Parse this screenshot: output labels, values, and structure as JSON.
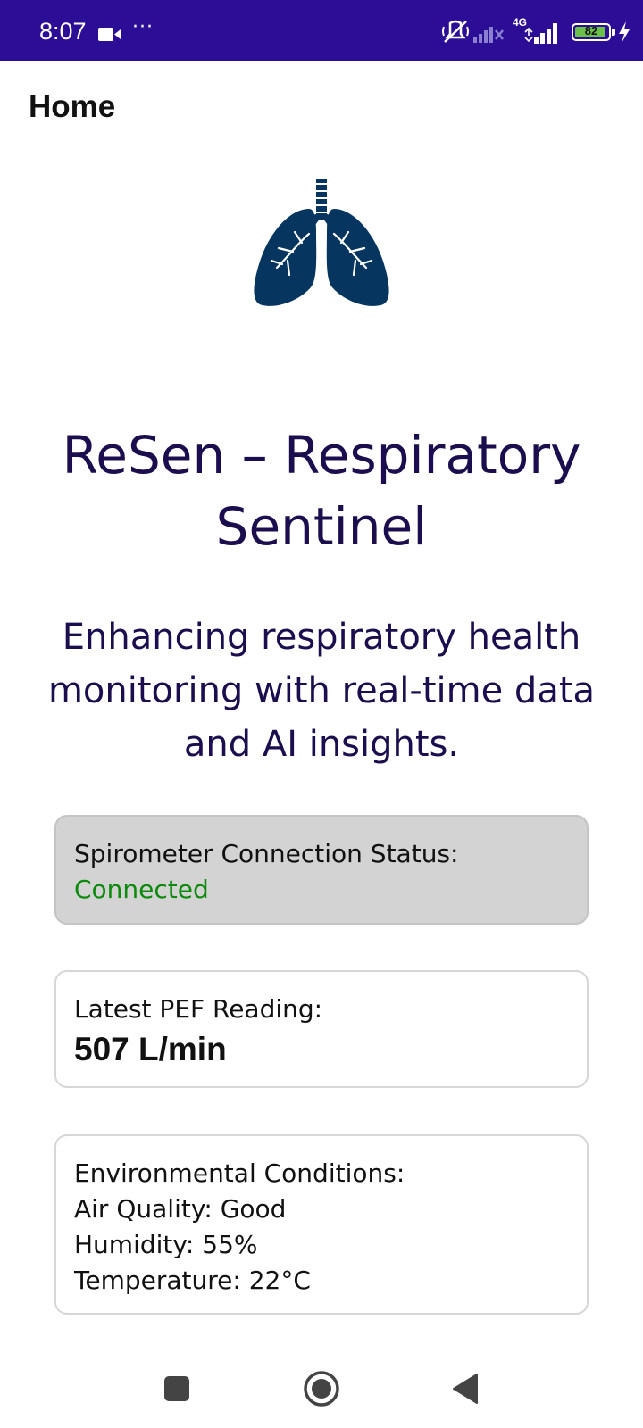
{
  "status_bar": {
    "time": "8:07",
    "dots": "···",
    "network": "4G",
    "battery": "82",
    "icons": [
      "video-camera-icon",
      "mute-icon",
      "signal-icon",
      "battery-icon",
      "charging-icon"
    ],
    "background": "#2c0d95"
  },
  "app_bar": {
    "title": "Home"
  },
  "logo": {
    "icon": "lungs-icon",
    "color": "#063660"
  },
  "main": {
    "title": "ReSen – Respiratory Sentinel",
    "tagline": "Enhancing respiratory health monitoring with real-time data and AI insights."
  },
  "connection_card": {
    "label": "Spirometer Connection Status:",
    "value": "Connected",
    "value_color": "#0b8a0b"
  },
  "pef_card": {
    "label": "Latest PEF Reading:",
    "value": "507 L/min"
  },
  "environment_card": {
    "label": "Environmental Conditions:",
    "air_quality": "Air Quality: Good",
    "humidity": "Humidity: 55%",
    "temperature": "Temperature: 22°C"
  },
  "nav_bar": {
    "icons": [
      "recents-square-icon",
      "home-circle-icon",
      "back-triangle-icon"
    ]
  }
}
